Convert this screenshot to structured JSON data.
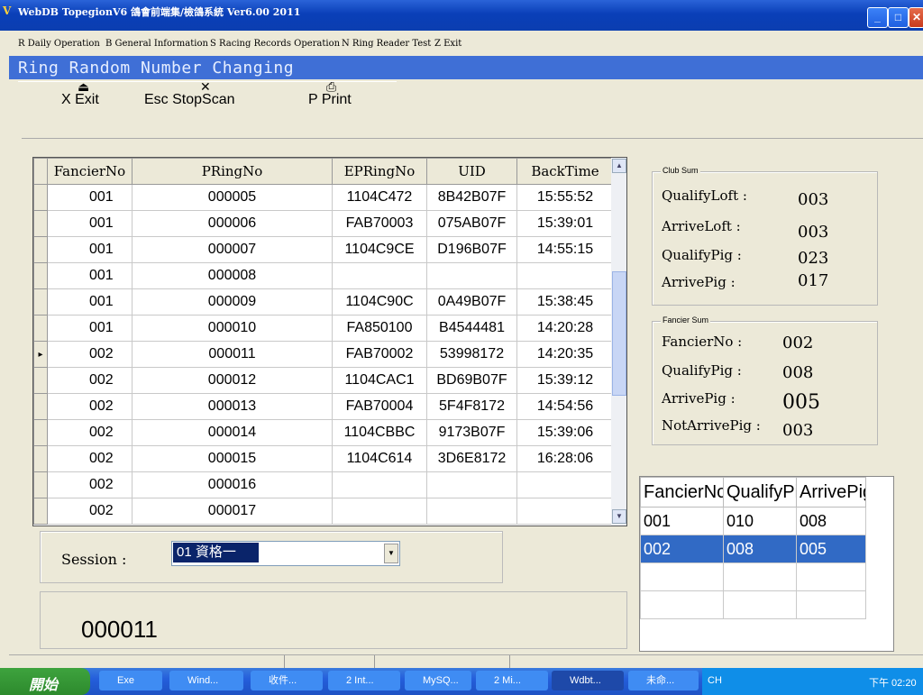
{
  "window": {
    "title": "WebDB TopegionV6 鴿會前端集/檢鴿系統 Ver6.00 2011"
  },
  "menu": [
    "R Daily Operation",
    "B General Information",
    "S Racing Records Operation",
    "N Ring Reader Test",
    "Z Exit"
  ],
  "header": {
    "title": "Ring Random Number Changing"
  },
  "toolbar": {
    "exit": "X Exit",
    "stopscan": "Esc StopScan",
    "print": "P Print"
  },
  "grid": {
    "columns": [
      "FancierNo",
      "PRingNo",
      "EPRingNo",
      "UID",
      "BackTime"
    ],
    "rows": [
      [
        "001",
        "000005",
        "1104C472",
        "8B42B07F",
        "15:55:52"
      ],
      [
        "001",
        "000006",
        "FAB70003",
        "075AB07F",
        "15:39:01"
      ],
      [
        "001",
        "000007",
        "1104C9CE",
        "D196B07F",
        "14:55:15"
      ],
      [
        "001",
        "000008",
        "",
        "",
        ""
      ],
      [
        "001",
        "000009",
        "1104C90C",
        "0A49B07F",
        "15:38:45"
      ],
      [
        "001",
        "000010",
        "FA850100",
        "B4544481",
        "14:20:28"
      ],
      [
        "002",
        "000011",
        "FAB70002",
        "53998172",
        "14:20:35"
      ],
      [
        "002",
        "000012",
        "1104CAC1",
        "BD69B07F",
        "15:39:12"
      ],
      [
        "002",
        "000013",
        "FAB70004",
        "5F4F8172",
        "14:54:56"
      ],
      [
        "002",
        "000014",
        "1104CBBC",
        "9173B07F",
        "15:39:06"
      ],
      [
        "002",
        "000015",
        "1104C614",
        "3D6E8172",
        "16:28:06"
      ],
      [
        "002",
        "000016",
        "",
        "",
        ""
      ],
      [
        "002",
        "000017",
        "",
        "",
        ""
      ]
    ]
  },
  "session": {
    "label": "Session :",
    "value": "01 資格一"
  },
  "current_ring": "000011",
  "club_sum": {
    "title": "Club Sum",
    "qualify_loft_label": "QualifyLoft :",
    "qualify_loft": "003",
    "arrive_loft_label": "ArriveLoft :",
    "arrive_loft": "003",
    "qualify_pig_label": "QualifyPig :",
    "qualify_pig": "023",
    "arrive_pig_label": "ArrivePig :",
    "arrive_pig": "017"
  },
  "fancier_sum": {
    "title": "Fancier Sum",
    "fancier_no_label": "FancierNo :",
    "fancier_no": "002",
    "qualify_pig_label": "QualifyPig :",
    "qualify_pig": "008",
    "arrive_pig_label": "ArrivePig :",
    "arrive_pig": "005",
    "not_arrive_label": "NotArrivePig :",
    "not_arrive": "003"
  },
  "summary_grid": {
    "columns": [
      "FancierNo",
      "QualifyPig",
      "ArrivePig"
    ],
    "rows": [
      [
        "001",
        "010",
        "008"
      ],
      [
        "002",
        "008",
        "005"
      ]
    ]
  },
  "taskbar": {
    "start": "開始",
    "tasks": [
      "Exe",
      "Wind...",
      "收件...",
      "2 Int...",
      "MySQ...",
      "2 Mi...",
      "Wdbt...",
      "未命..."
    ],
    "ime": "CH",
    "clock": "下午 02:20"
  }
}
